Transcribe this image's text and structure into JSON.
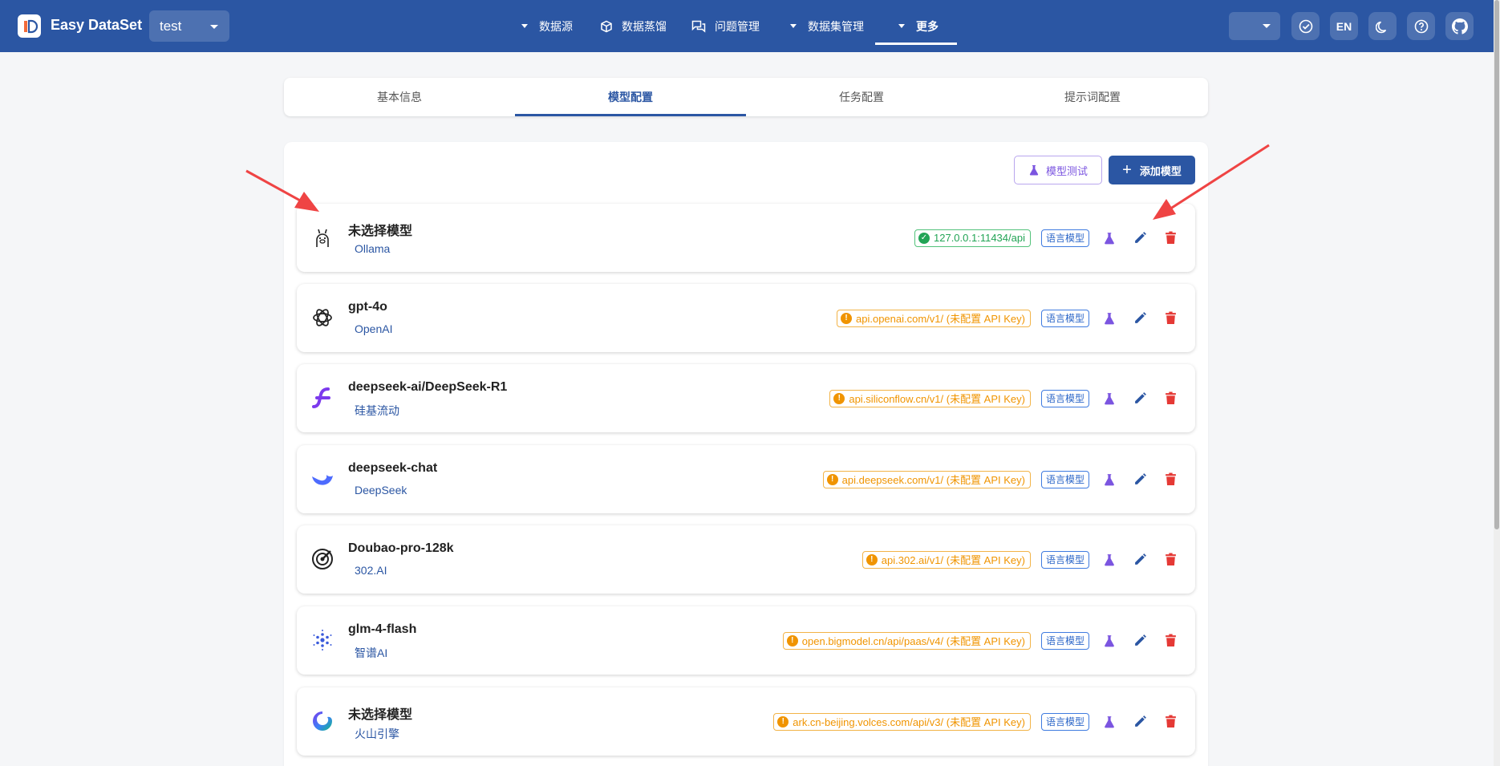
{
  "app": {
    "title": "Easy DataSet",
    "project": "test"
  },
  "nav": {
    "items": [
      {
        "label": "数据源",
        "has_dropdown": true,
        "icon": null
      },
      {
        "label": "数据蒸馏",
        "has_dropdown": false,
        "icon": "cube-icon"
      },
      {
        "label": "问题管理",
        "has_dropdown": false,
        "icon": "chat-icon"
      },
      {
        "label": "数据集管理",
        "has_dropdown": true,
        "icon": null
      },
      {
        "label": "更多",
        "has_dropdown": true,
        "icon": null,
        "active": true
      }
    ]
  },
  "topright": {
    "lang_label": "EN"
  },
  "tabs": [
    {
      "label": "基本信息",
      "active": false
    },
    {
      "label": "模型配置",
      "active": true
    },
    {
      "label": "任务配置",
      "active": false
    },
    {
      "label": "提示词配置",
      "active": false
    }
  ],
  "actions": {
    "test_label": "模型测试",
    "add_label": "添加模型"
  },
  "models": [
    {
      "name": "未选择模型",
      "provider": "Ollama",
      "icon": "ollama-icon",
      "endpoint": "127.0.0.1:11434/api",
      "status": "ok",
      "type": "语言模型"
    },
    {
      "name": "gpt-4o",
      "provider": "OpenAI",
      "icon": "openai-icon",
      "endpoint": "api.openai.com/v1/ (未配置 API Key)",
      "status": "warn",
      "type": "语言模型"
    },
    {
      "name": "deepseek-ai/DeepSeek-R1",
      "provider": "硅基流动",
      "icon": "siliconflow-icon",
      "endpoint": "api.siliconflow.cn/v1/ (未配置 API Key)",
      "status": "warn",
      "type": "语言模型"
    },
    {
      "name": "deepseek-chat",
      "provider": "DeepSeek",
      "icon": "deepseek-icon",
      "endpoint": "api.deepseek.com/v1/ (未配置 API Key)",
      "status": "warn",
      "type": "语言模型"
    },
    {
      "name": "Doubao-pro-128k",
      "provider": "302.AI",
      "icon": "302ai-icon",
      "endpoint": "api.302.ai/v1/ (未配置 API Key)",
      "status": "warn",
      "type": "语言模型"
    },
    {
      "name": "glm-4-flash",
      "provider": "智谱AI",
      "icon": "zhipu-icon",
      "endpoint": "open.bigmodel.cn/api/paas/v4/ (未配置 API Key)",
      "status": "warn",
      "type": "语言模型"
    },
    {
      "name": "未选择模型",
      "provider": "火山引擎",
      "icon": "volcengine-icon",
      "endpoint": "ark.cn-beijing.volces.com/api/v3/ (未配置 API Key)",
      "status": "warn",
      "type": "语言模型"
    }
  ],
  "colors": {
    "primary": "#2b56a3",
    "accent_purple": "#7b55e0",
    "ok": "#22a455",
    "warn": "#f09400",
    "danger": "#e53935",
    "annotation_arrow": "#ef4444"
  }
}
